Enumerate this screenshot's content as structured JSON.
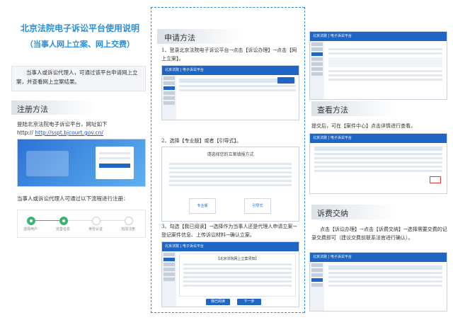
{
  "left": {
    "title_line1": "北京法院电子诉讼平台使用说明",
    "title_line2": "（当事人网上立案、网上交费）",
    "intro": "当事人或诉讼代理人，可通过该平台申请网上立案，并查看网上立案结果。",
    "register_heading": "注册方法",
    "register_text": "登陆北京法院电子诉讼平台，网址如下",
    "url_prefix": "http://",
    "url": "http://sspt.bjcourt.gov.cn/",
    "flow_text": "当事人或诉讼代理人可通过以下流程进行注册：",
    "steps": [
      "选择用户",
      "完善信息",
      "身份认证",
      "完成注册"
    ]
  },
  "middle": {
    "heading": "申请方法",
    "step1": "1、登录北京法院电子诉讼平台→点击【诉讼办理】→点击【网上立案】。",
    "step2": "2、选择【专业版】或者【引导式】。",
    "step3": "3、勾选【我已阅读】→选择作为当事人还是代理人申请立案→登记案件信息、上传诉讼材料→确认立案。",
    "nav_label": "北京法院 | 电子诉讼平台",
    "dialog_title": "请选择您的立案填报方式",
    "option_pro": "专业版",
    "option_guide": "引导式",
    "notice_title": "【北京法院网上立案须知】",
    "agree_btn": "我已阅读",
    "next_btn": "下一步"
  },
  "right": {
    "view_heading": "查看方法",
    "view_text": "提交后，可在【案件中心】点击详情进行查看。",
    "pay_heading": "诉费交纳",
    "pay_text": "点击【诉讼办理】→点击【诉费交纳】→选择需要交费的记录交费即可（建议交费前联系法官进行确认）。",
    "nav_label": "北京法院 | 电子诉讼平台"
  },
  "colors": {
    "accent": "#2a8fd8",
    "nav": "#1f66c4",
    "step_done": "#3cb371"
  }
}
